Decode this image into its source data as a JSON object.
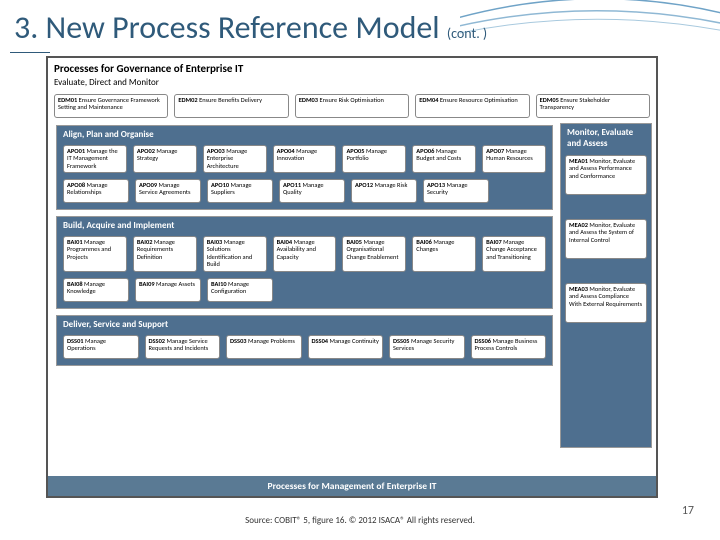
{
  "slide": {
    "title": "3. New Process Reference Model",
    "cont": "(cont. )",
    "page": "17",
    "source": "Source:  COBIT® 5, figure 16. © 2012 ISACA®  All rights reserved."
  },
  "diagram": {
    "header": "Processes for Governance of Enterprise IT",
    "sub": "Evaluate, Direct and Monitor",
    "footer": "Processes for Management of Enterprise IT",
    "edm": [
      {
        "c": "EDM01",
        "t": "Ensure Governance Framework Setting and Maintenance"
      },
      {
        "c": "EDM02",
        "t": "Ensure Benefits Delivery"
      },
      {
        "c": "EDM03",
        "t": "Ensure Risk Optimisation"
      },
      {
        "c": "EDM04",
        "t": "Ensure Resource Optimisation"
      },
      {
        "c": "EDM05",
        "t": "Ensure Stakeholder Transparency"
      }
    ],
    "apo": {
      "title": "Align, Plan and Organise",
      "r1": [
        {
          "c": "APO01",
          "t": "Manage the IT Management Framework"
        },
        {
          "c": "APO02",
          "t": "Manage Strategy"
        },
        {
          "c": "APO03",
          "t": "Manage Enterprise Architecture"
        },
        {
          "c": "APO04",
          "t": "Manage Innovation"
        },
        {
          "c": "APO05",
          "t": "Manage Portfolio"
        },
        {
          "c": "APO06",
          "t": "Manage Budget and Costs"
        },
        {
          "c": "APO07",
          "t": "Manage Human Resources"
        }
      ],
      "r2": [
        {
          "c": "APO08",
          "t": "Manage Relationships"
        },
        {
          "c": "APO09",
          "t": "Manage Service Agreements"
        },
        {
          "c": "APO10",
          "t": "Manage Suppliers"
        },
        {
          "c": "APO11",
          "t": "Manage Quality"
        },
        {
          "c": "APO12",
          "t": "Manage Risk"
        },
        {
          "c": "APO13",
          "t": "Manage Security"
        }
      ]
    },
    "bai": {
      "title": "Build, Acquire and Implement",
      "r1": [
        {
          "c": "BAI01",
          "t": "Manage Programmes and Projects"
        },
        {
          "c": "BAI02",
          "t": "Manage Requirements Definition"
        },
        {
          "c": "BAI03",
          "t": "Manage Solutions Identification and Build"
        },
        {
          "c": "BAI04",
          "t": "Manage Availability and Capacity"
        },
        {
          "c": "BAI05",
          "t": "Manage Organisational Change Enablement"
        },
        {
          "c": "BAI06",
          "t": "Manage Changes"
        },
        {
          "c": "BAI07",
          "t": "Manage Change Acceptance and Transitioning"
        }
      ],
      "r2": [
        {
          "c": "BAI08",
          "t": "Manage Knowledge"
        },
        {
          "c": "BAI09",
          "t": "Manage Assets"
        },
        {
          "c": "BAI10",
          "t": "Manage Configuration"
        }
      ]
    },
    "dss": {
      "title": "Deliver, Service and Support",
      "r1": [
        {
          "c": "DSS01",
          "t": "Manage Operations"
        },
        {
          "c": "DSS02",
          "t": "Manage Service Requests and Incidents"
        },
        {
          "c": "DSS03",
          "t": "Manage Problems"
        },
        {
          "c": "DSS04",
          "t": "Manage Continuity"
        },
        {
          "c": "DSS05",
          "t": "Manage Security Services"
        },
        {
          "c": "DSS06",
          "t": "Manage Business Process Controls"
        }
      ]
    },
    "mea": {
      "title": "Monitor, Evaluate and Assess",
      "items": [
        {
          "c": "MEA01",
          "t": "Monitor, Evaluate and Assess Performance and Conformance"
        },
        {
          "c": "MEA02",
          "t": "Monitor, Evaluate and Assess the System of Internal Control"
        },
        {
          "c": "MEA03",
          "t": "Monitor, Evaluate and Assess Compliance With External Requirements"
        }
      ]
    }
  }
}
